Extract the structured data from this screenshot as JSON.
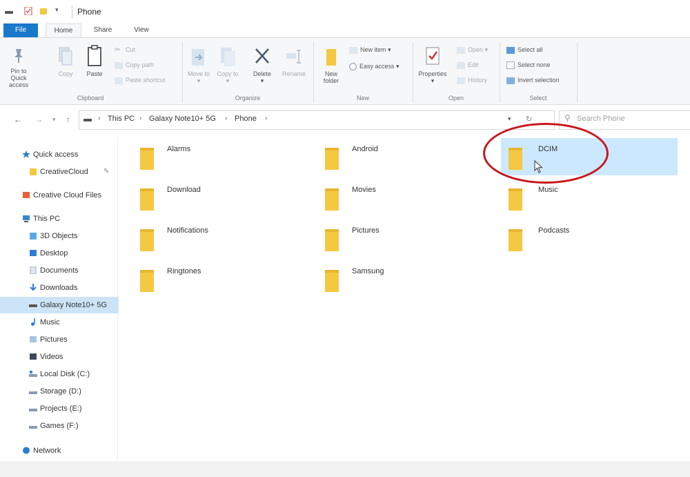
{
  "window": {
    "title": "Phone"
  },
  "tabs": [
    {
      "label": "File"
    },
    {
      "label": "Home"
    },
    {
      "label": "Share"
    },
    {
      "label": "View"
    }
  ],
  "ribbon": {
    "clipboard": {
      "group": "Clipboard",
      "pin": "Pin to Quick access",
      "copy": "Copy",
      "paste": "Paste",
      "cut": "Cut",
      "copy_path": "Copy path",
      "paste_shortcut": "Paste shortcut"
    },
    "organize": {
      "group": "Organize",
      "move_to": "Move to",
      "copy_to": "Copy to",
      "delete": "Delete",
      "rename": "Rename"
    },
    "new": {
      "group": "New",
      "new_folder": "New folder",
      "new_item": "New item",
      "easy_access": "Easy access"
    },
    "open": {
      "group": "Open",
      "properties": "Properties",
      "open": "Open",
      "edit": "Edit",
      "history": "History"
    },
    "select": {
      "group": "Select",
      "select_all": "Select all",
      "select_none": "Select none",
      "invert_selection": "Invert selection"
    }
  },
  "address": {
    "breadcrumbs": [
      "This PC",
      "Galaxy Note10+ 5G",
      "Phone"
    ],
    "search_placeholder": "Search Phone"
  },
  "sidebar": {
    "items": [
      {
        "label": "Quick access"
      },
      {
        "label": "CreativeCloud"
      },
      {
        "label": "Creative Cloud Files"
      },
      {
        "label": "This PC"
      },
      {
        "label": "3D Objects"
      },
      {
        "label": "Desktop"
      },
      {
        "label": "Documents"
      },
      {
        "label": "Downloads"
      },
      {
        "label": "Galaxy Note10+ 5G"
      },
      {
        "label": "Music"
      },
      {
        "label": "Pictures"
      },
      {
        "label": "Videos"
      },
      {
        "label": "Local Disk (C:)"
      },
      {
        "label": "Storage (D:)"
      },
      {
        "label": "Projects (E:)"
      },
      {
        "label": "Games (F:)"
      },
      {
        "label": "Network"
      }
    ],
    "selected": "Galaxy Note10+ 5G"
  },
  "folders": [
    {
      "name": "Alarms"
    },
    {
      "name": "Android"
    },
    {
      "name": "DCIM"
    },
    {
      "name": "Download"
    },
    {
      "name": "Movies"
    },
    {
      "name": "Music"
    },
    {
      "name": "Notifications"
    },
    {
      "name": "Pictures"
    },
    {
      "name": "Podcasts"
    },
    {
      "name": "Ringtones"
    },
    {
      "name": "Samsung"
    }
  ],
  "selected_folder": "DCIM",
  "colors": {
    "accent": "#1979ca",
    "folder": "#f5c842",
    "selection": "#cce8ff",
    "highlight": "#c8161d"
  }
}
